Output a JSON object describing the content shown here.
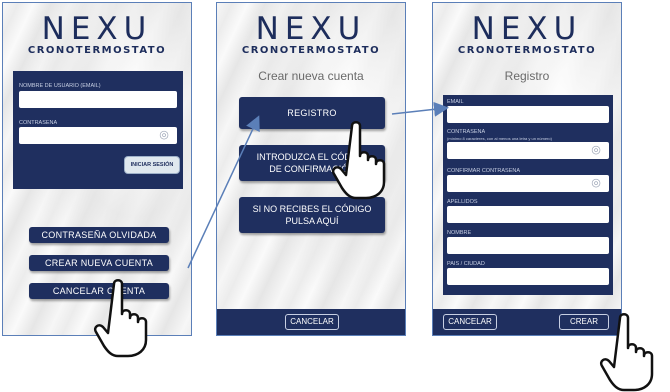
{
  "brand": {
    "logo": "NEXU",
    "subtitle": "CRONOTERMOSTATO"
  },
  "screen_login": {
    "username_label": "NOMBRE DE USUARIO (EMAIL)",
    "password_label": "CONTRASEÑA",
    "login_button": "INICIAR SESIÓN",
    "forgot_password_button": "CONTRASEÑA OLVIDADA",
    "create_account_button": "CREAR NUEVA CUENTA",
    "cancel_account_button": "CANCELAR CUENTA"
  },
  "screen_create": {
    "title": "Crear nueva cuenta",
    "register_button": "REGISTRO",
    "code_button_line1": "INTRODUZCA EL CÓDIGO",
    "code_button_line2": "DE CONFIRMACIÓN",
    "no_code_line1": "SI NO RECIBES EL CÓDIGO",
    "no_code_line2": "PULSA AQUÍ",
    "cancel_button": "CANCELAR"
  },
  "screen_register": {
    "title": "Registro",
    "email_label": "EMAIL",
    "password_label": "CONTRASEÑA",
    "password_hint": "(mínimo 8 caracteres, con al menos una letra y un número)",
    "confirm_password_label": "CONFIRMAR CONTRASEÑA",
    "surname_label": "APELLIDOS",
    "name_label": "NOMBRE",
    "country_label": "PAÍS / CIUDAD",
    "cancel_button": "CANCELAR",
    "create_button": "CREAR"
  },
  "colors": {
    "navy": "#1f2f5f",
    "logo": "#1d2d5c",
    "arrow": "#5b7fb8"
  },
  "icons": [
    "eye-icon",
    "pointing-hand-icon",
    "flow-arrow"
  ]
}
